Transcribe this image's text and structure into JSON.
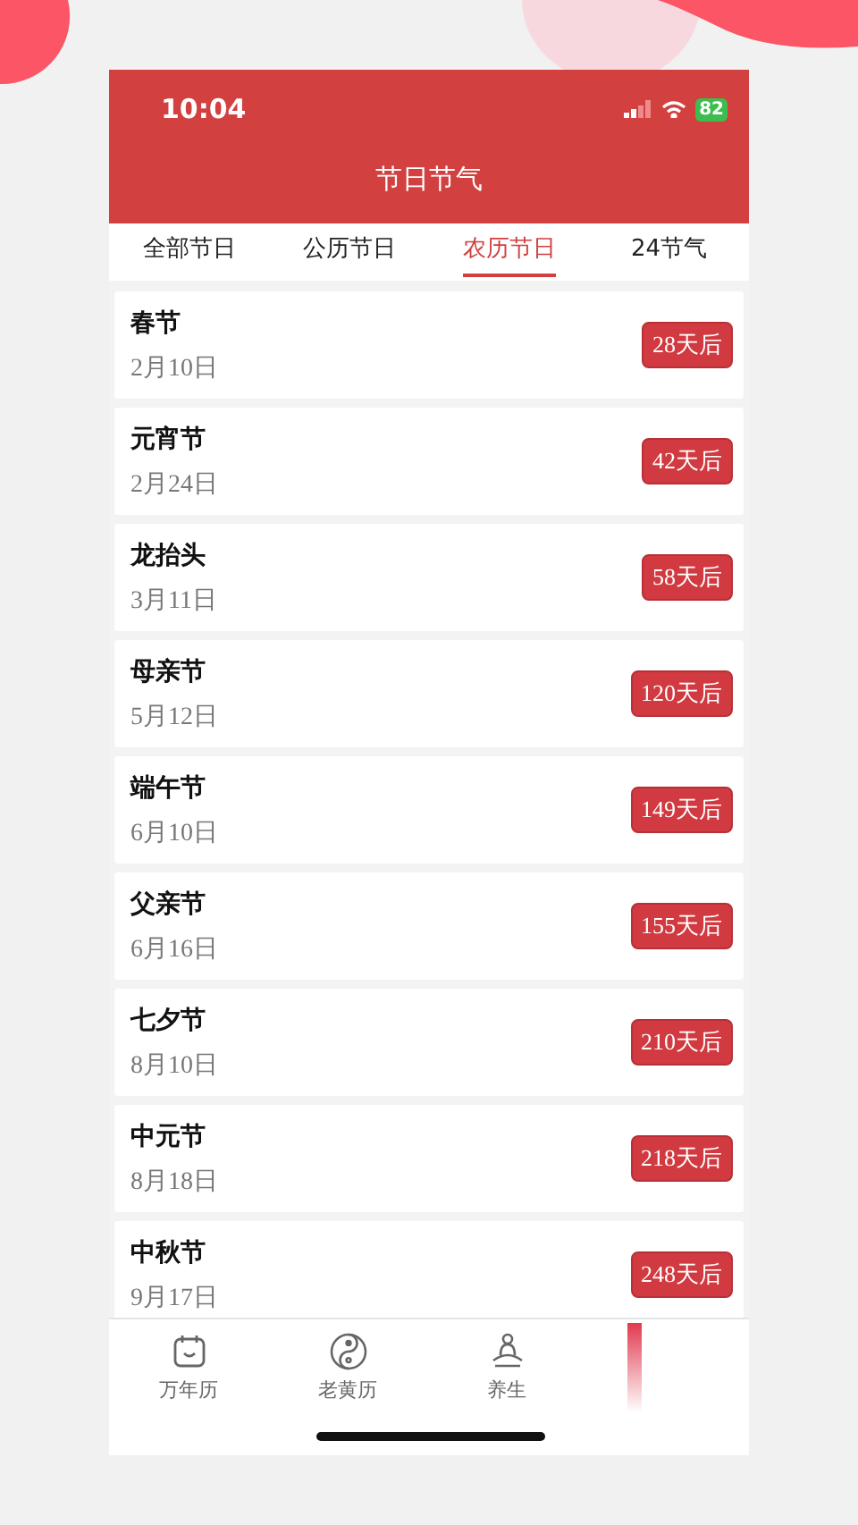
{
  "status_bar": {
    "time": "10:04",
    "battery": "82"
  },
  "header": {
    "title": "节日节气"
  },
  "tabs": [
    {
      "label": "全部节日",
      "selected": false
    },
    {
      "label": "公历节日",
      "selected": false
    },
    {
      "label": "农历节日",
      "selected": true
    },
    {
      "label": "24节气",
      "selected": false
    }
  ],
  "festivals": [
    {
      "name": "春节",
      "date": "2月10日",
      "countdown": "28天后"
    },
    {
      "name": "元宵节",
      "date": "2月24日",
      "countdown": "42天后"
    },
    {
      "name": "龙抬头",
      "date": "3月11日",
      "countdown": "58天后"
    },
    {
      "name": "母亲节",
      "date": "5月12日",
      "countdown": "120天后"
    },
    {
      "name": "端午节",
      "date": "6月10日",
      "countdown": "149天后"
    },
    {
      "name": "父亲节",
      "date": "6月16日",
      "countdown": "155天后"
    },
    {
      "name": "七夕节",
      "date": "8月10日",
      "countdown": "210天后"
    },
    {
      "name": "中元节",
      "date": "8月18日",
      "countdown": "218天后"
    },
    {
      "name": "中秋节",
      "date": "9月17日",
      "countdown": "248天后"
    }
  ],
  "bottom_nav": [
    {
      "kind": "calendar",
      "label": "万年历"
    },
    {
      "kind": "yinyang",
      "label": "老黄历"
    },
    {
      "kind": "meditation",
      "label": "养生"
    }
  ]
}
